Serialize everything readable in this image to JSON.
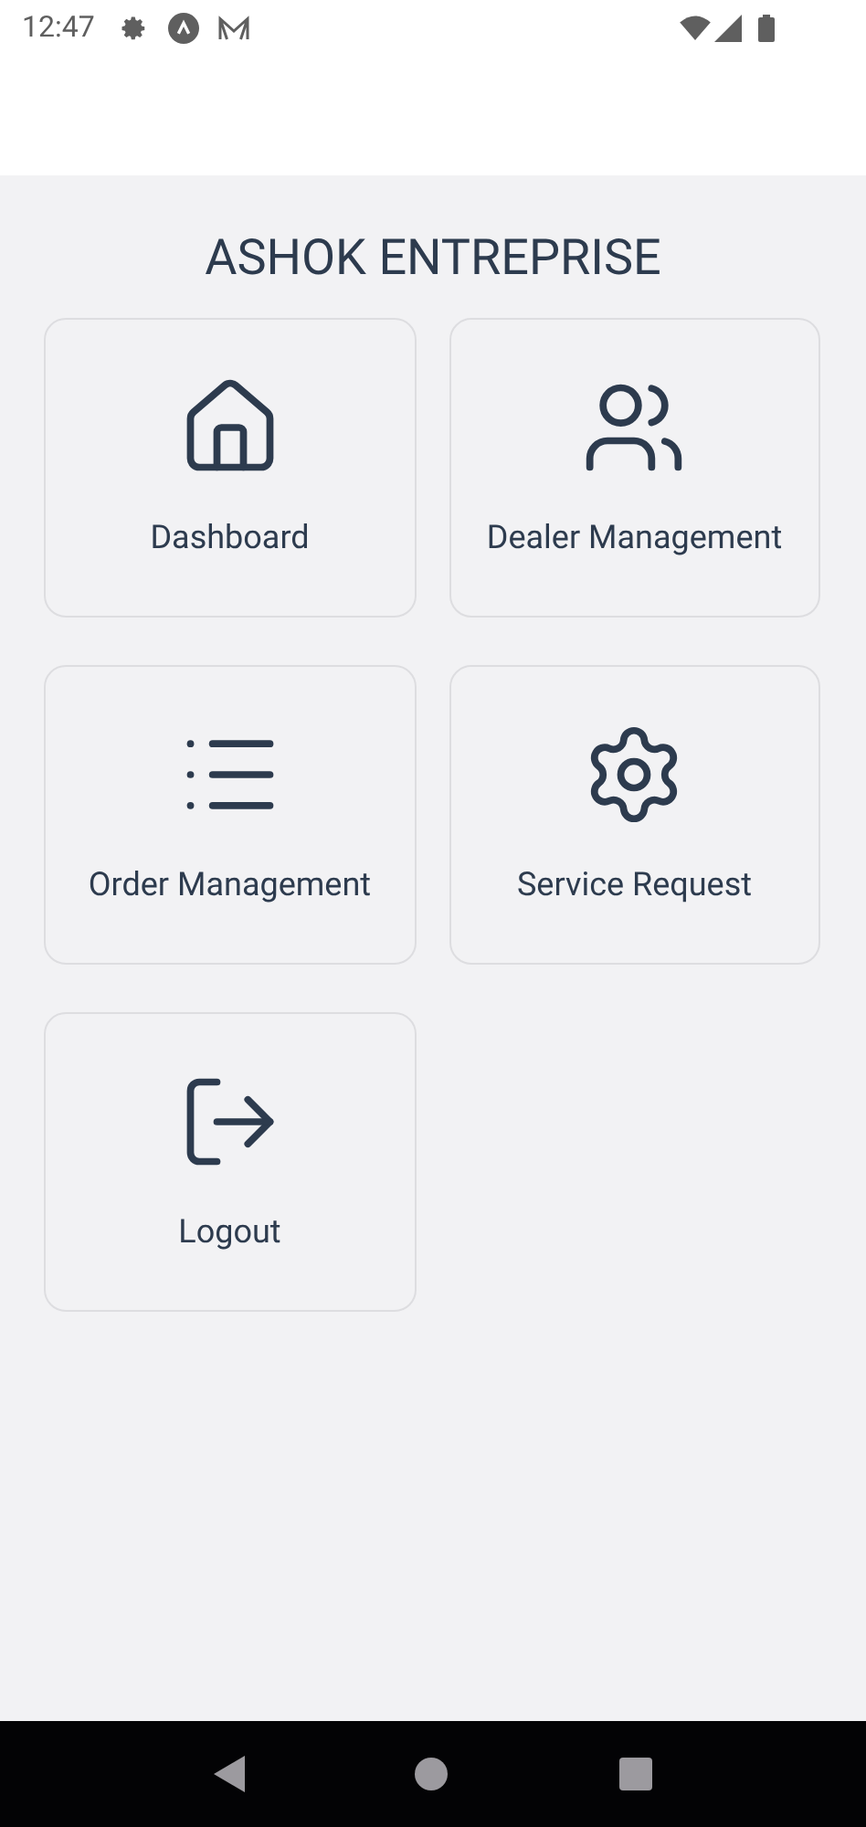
{
  "status_bar": {
    "time": "12:47"
  },
  "title": "ASHOK ENTREPRISE",
  "tiles": [
    {
      "kind": "home",
      "label": "Dashboard"
    },
    {
      "kind": "users",
      "label": "Dealer Management"
    },
    {
      "kind": "list",
      "label": "Order Management"
    },
    {
      "kind": "gear",
      "label": "Service Request"
    },
    {
      "kind": "logout",
      "label": "Logout"
    }
  ]
}
